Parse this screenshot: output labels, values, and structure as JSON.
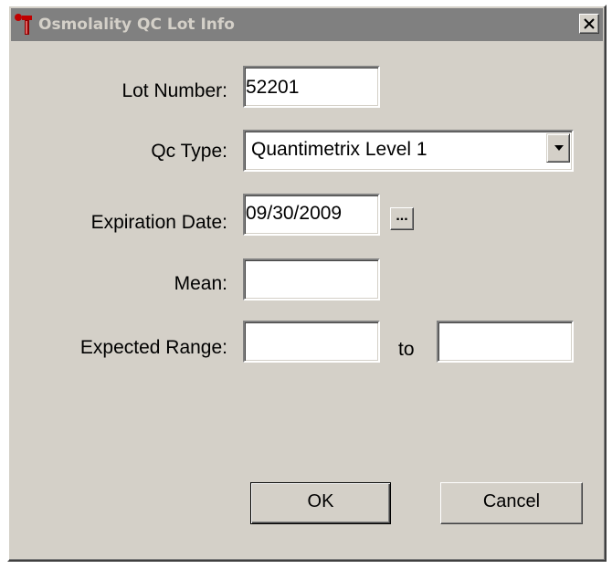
{
  "window": {
    "title": "Osmolality QC Lot Info"
  },
  "form": {
    "lot_number": {
      "label": "Lot Number:",
      "value": "52201"
    },
    "qc_type": {
      "label": "Qc Type:",
      "value": "Quantimetrix Level 1"
    },
    "expiration_date": {
      "label": "Expiration Date:",
      "value": "09/30/2009",
      "picker_label": "..."
    },
    "mean": {
      "label": "Mean:",
      "value": ""
    },
    "expected_range": {
      "label": "Expected Range:",
      "from_value": "",
      "separator": "to",
      "to_value": ""
    }
  },
  "buttons": {
    "ok": "OK",
    "cancel": "Cancel"
  },
  "colors": {
    "face": "#d4d0c8",
    "inactive_titlebar": "#808080",
    "field_bg": "#ffffff"
  },
  "icons": {
    "app": "osmometer-app-icon",
    "close": "close-icon",
    "dropdown": "chevron-down-icon"
  }
}
